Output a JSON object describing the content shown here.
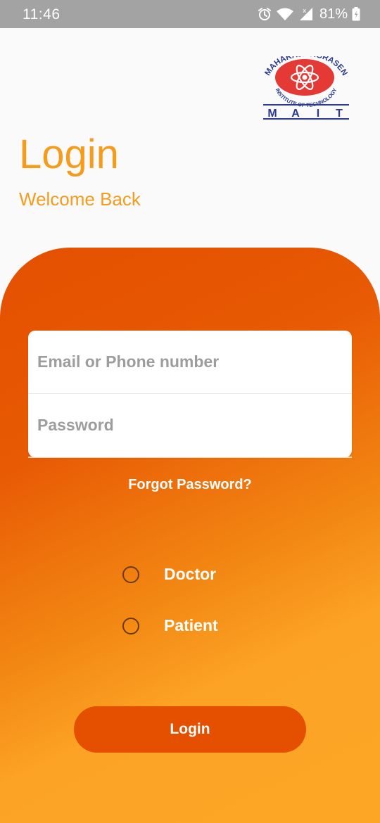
{
  "status_bar": {
    "time": "11:46",
    "battery_percent": "81%"
  },
  "logo": {
    "arc_text": "MAHARAJA AGRASEN",
    "inner_text": "INSTITUTE OF TECHNOLOGY",
    "letters": [
      "M",
      "A",
      "I",
      "T"
    ]
  },
  "header": {
    "title": "Login",
    "subtitle": "Welcome Back"
  },
  "form": {
    "email_placeholder": "Email or Phone number",
    "password_placeholder": "Password",
    "forgot_label": "Forgot Password?"
  },
  "roles": [
    {
      "label": "Doctor",
      "selected": false
    },
    {
      "label": "Patient",
      "selected": false
    }
  ],
  "login_button": {
    "label": "Login"
  },
  "colors": {
    "accent": "#f59c1c",
    "button": "#e45000",
    "status_bar": "#a3a3a3",
    "logo_red": "#e53935",
    "logo_blue": "#2b3990"
  }
}
